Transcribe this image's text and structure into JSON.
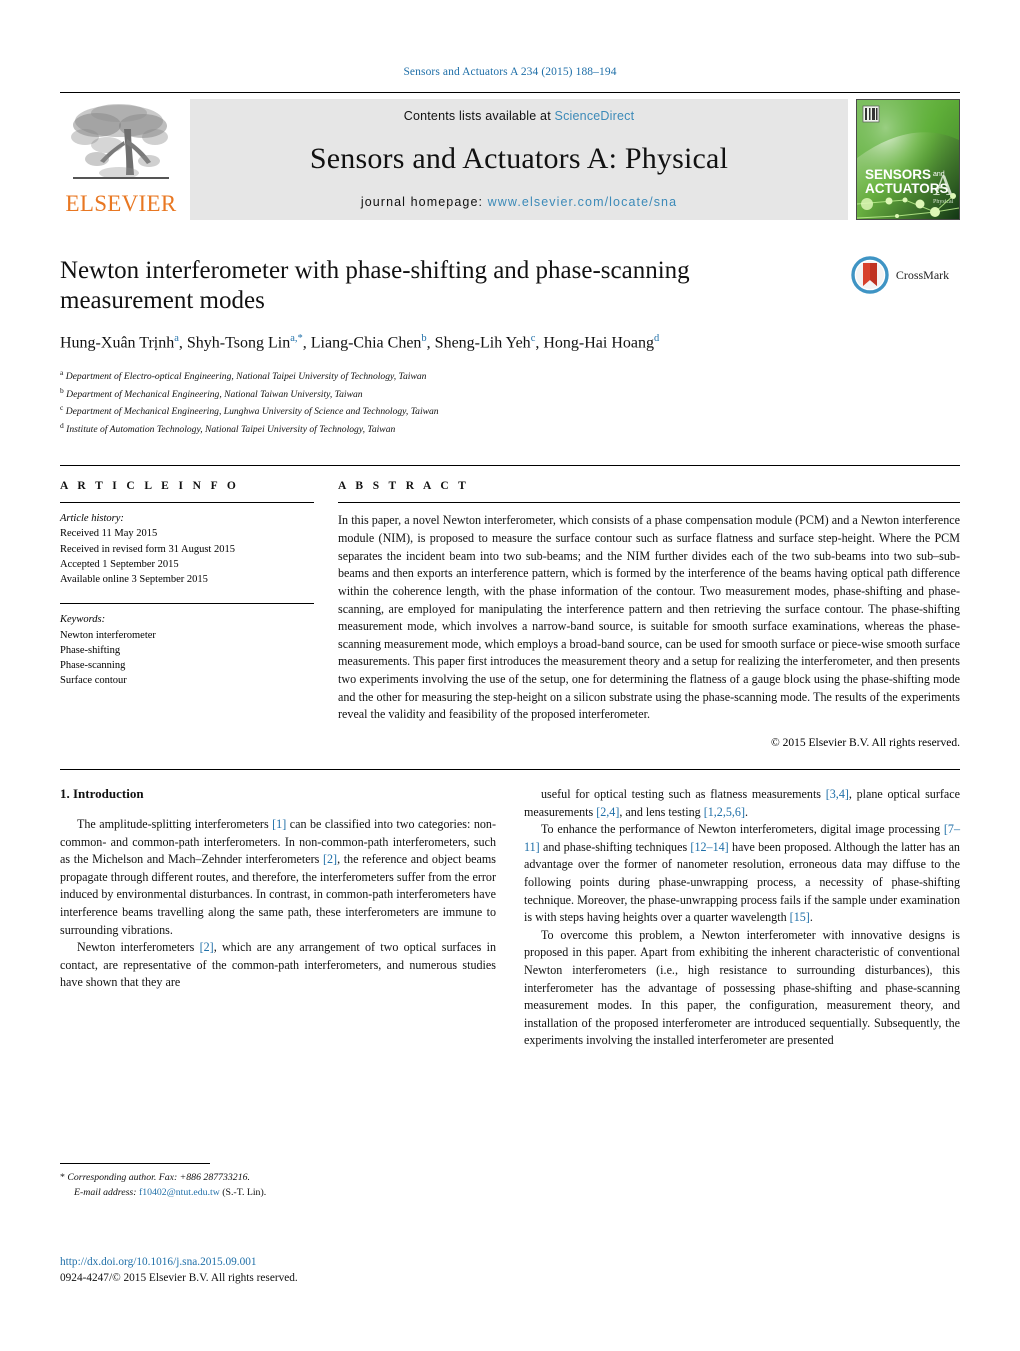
{
  "running_head": "Sensors and Actuators A 234 (2015) 188–194",
  "masthead": {
    "publisher": "ELSEVIER",
    "contents_prefix": "Contents lists available at ",
    "contents_link": "ScienceDirect",
    "journal_title": "Sensors and Actuators A: Physical",
    "homepage_prefix": "journal homepage: ",
    "homepage_link": "www.elsevier.com/locate/sna",
    "cover": {
      "line1": "SENSORS",
      "and": "and",
      "line2": "ACTUATORS",
      "letter": "A",
      "sub": "Physical"
    },
    "colors": {
      "link": "#3c8ab8",
      "band": "#e6e6e6",
      "elsevier_orange": "#E87722",
      "cover_green": "#4aa528"
    }
  },
  "crossmark": {
    "label": "CrossMark"
  },
  "article": {
    "title": "Newton interferometer with phase-shifting and phase-scanning measurement modes",
    "authors_html": "Hung-Xuân Trịnh<sup>a</sup>, Shyh-Tsong Lin<sup>a,</sup><sup>*</sup>, Liang-Chia Chen<sup>b</sup>, Sheng-Lih Yeh<sup>c</sup>, Hong-Hai Hoang<sup>d</sup>",
    "affiliations": [
      {
        "marker": "a",
        "text": "Department of Electro-optical Engineering, National Taipei University of Technology, Taiwan"
      },
      {
        "marker": "b",
        "text": "Department of Mechanical Engineering, National Taiwan University, Taiwan"
      },
      {
        "marker": "c",
        "text": "Department of Mechanical Engineering, Lunghwa University of Science and Technology, Taiwan"
      },
      {
        "marker": "d",
        "text": "Institute of Automation Technology, National Taipei University of Technology, Taiwan"
      }
    ]
  },
  "article_info": {
    "heading": "A R T I C L E   I N F O",
    "history_label": "Article history:",
    "history": [
      "Received 11 May 2015",
      "Received in revised form 31 August 2015",
      "Accepted 1 September 2015",
      "Available online 3 September 2015"
    ],
    "keywords_label": "Keywords:",
    "keywords": [
      "Newton interferometer",
      "Phase-shifting",
      "Phase-scanning",
      "Surface contour"
    ]
  },
  "abstract": {
    "heading": "A B S T R A C T",
    "text": "In this paper, a novel Newton interferometer, which consists of a phase compensation module (PCM) and a Newton interference module (NIM), is proposed to measure the surface contour such as surface flatness and surface step-height. Where the PCM separates the incident beam into two sub-beams; and the NIM further divides each of the two sub-beams into two sub–sub-beams and then exports an interference pattern, which is formed by the interference of the beams having optical path difference within the coherence length, with the phase information of the contour. Two measurement modes, phase-shifting and phase-scanning, are employed for manipulating the interference pattern and then retrieving the surface contour. The phase-shifting measurement mode, which involves a narrow-band source, is suitable for smooth surface examinations, whereas the phase-scanning measurement mode, which employs a broad-band source, can be used for smooth surface or piece-wise smooth surface measurements. This paper first introduces the measurement theory and a setup for realizing the interferometer, and then presents two experiments involving the use of the setup, one for determining the flatness of a gauge block using the phase-shifting mode and the other for measuring the step-height on a silicon substrate using the phase-scanning mode. The results of the experiments reveal the validity and feasibility of the proposed interferometer.",
    "copyright": "© 2015 Elsevier B.V. All rights reserved."
  },
  "body": {
    "section_number_title": "1.  Introduction",
    "left_paragraphs": [
      "The amplitude-splitting interferometers [1] can be classified into two categories: non-common- and common-path interferometers. In non-common-path interferometers, such as the Michelson and Mach–Zehnder interferometers [2], the reference and object beams propagate through different routes, and therefore, the interferometers suffer from the error induced by environmental disturbances. In contrast, in common-path interferometers have interference beams travelling along the same path, these interferometers are immune to surrounding vibrations.",
      "Newton interferometers [2], which are any arrangement of two optical surfaces in contact, are representative of the common-path interferometers, and numerous studies have shown that they are"
    ],
    "right_paragraphs": [
      "useful for optical testing such as flatness measurements [3,4], plane optical surface measurements [2,4], and lens testing [1,2,5,6].",
      "To enhance the performance of Newton interferometers, digital image processing [7–11] and phase-shifting techniques [12–14] have been proposed. Although the latter has an advantage over the former of nanometer resolution, erroneous data may diffuse to the following points during phase-unwrapping process, a necessity of phase-shifting technique. Moreover, the phase-unwrapping process fails if the sample under examination is with steps having heights over a quarter wavelength [15].",
      "To overcome this problem, a Newton interferometer with innovative designs is proposed in this paper. Apart from exhibiting the inherent characteristic of conventional Newton interferometers (i.e., high resistance to surrounding disturbances), this interferometer has the advantage of possessing phase-shifting and phase-scanning measurement modes. In this paper, the configuration, measurement theory, and installation of the proposed interferometer are introduced sequentially. Subsequently, the experiments involving the installed interferometer are presented"
    ]
  },
  "footnote": {
    "star": "*",
    "corresponding": "Corresponding author. Fax: +886 287733216.",
    "email_label": "E-mail address:",
    "email": "f10402@ntut.edu.tw",
    "email_suffix": "(S.-T. Lin)."
  },
  "footer": {
    "doi": "http://dx.doi.org/10.1016/j.sna.2015.09.001",
    "issn": "0924-4247/© 2015 Elsevier B.V. All rights reserved."
  }
}
